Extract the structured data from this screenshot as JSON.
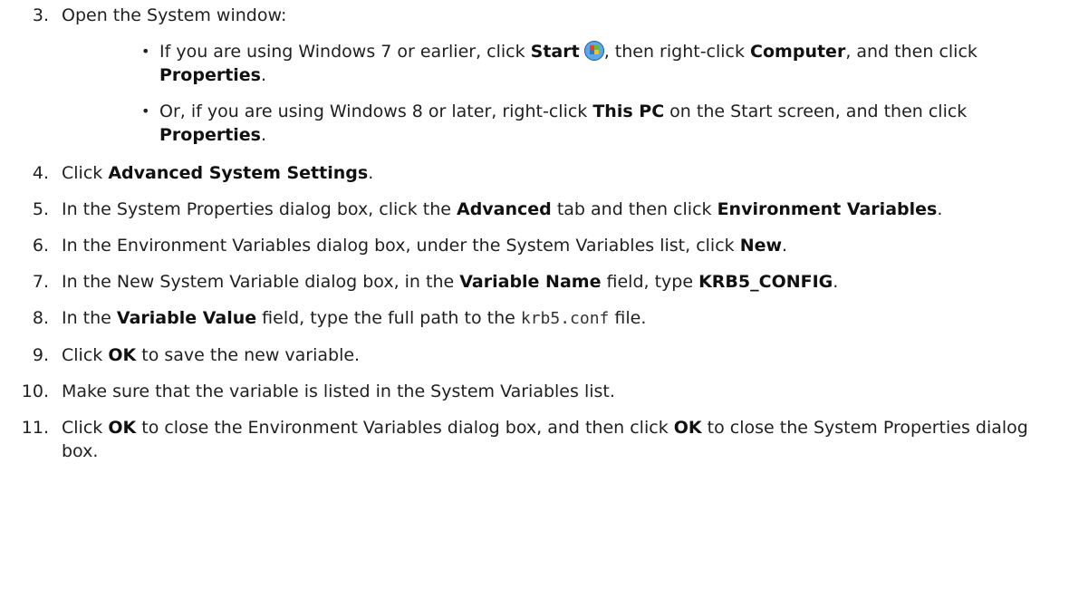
{
  "steps": [
    {
      "num": "3.",
      "text": "Open the System window:",
      "substeps": [
        {
          "bullet": "•",
          "p1": "If you are using Windows 7 or earlier, click ",
          "b1": "Start",
          "icon": "windows-start-orb-icon",
          "p2": ", then right-click ",
          "b2": "Computer",
          "p3": ", and then click ",
          "b3": "Properties",
          "p4": "."
        },
        {
          "bullet": "•",
          "p1": "Or, if you are using Windows 8 or later, right-click ",
          "b1": "This PC",
          "p2": " on the Start screen, and then click ",
          "b2": "Properties",
          "p3": "."
        }
      ]
    },
    {
      "num": "4.",
      "p1": "Click ",
      "b1": "Advanced System Settings",
      "p2": "."
    },
    {
      "num": "5.",
      "p1": "In the System Properties dialog box, click the ",
      "b1": "Advanced",
      "p2": " tab and then click ",
      "b2": "Environment Variables",
      "p3": "."
    },
    {
      "num": "6.",
      "p1": "In the Environment Variables dialog box, under the System Variables list, click ",
      "b1": "New",
      "p2": "."
    },
    {
      "num": "7.",
      "p1": "In the New System Variable dialog box, in the ",
      "b1": "Variable Name",
      "p2": " field, type ",
      "b2": "KRB5_CONFIG",
      "p3": "."
    },
    {
      "num": "8.",
      "p1": "In the ",
      "b1": "Variable Value",
      "p2": " field, type the full path to the ",
      "code": "krb5.conf",
      "p3": " file."
    },
    {
      "num": "9.",
      "p1": "Click ",
      "b1": "OK",
      "p2": " to save the new variable."
    },
    {
      "num": "10.",
      "text": "Make sure that the variable is listed in the System Variables list."
    },
    {
      "num": "11.",
      "p1": "Click ",
      "b1": "OK",
      "p2": " to close the Environment Variables dialog box, and then click ",
      "b2": "OK",
      "p3": " to close the System Properties dialog box."
    }
  ]
}
